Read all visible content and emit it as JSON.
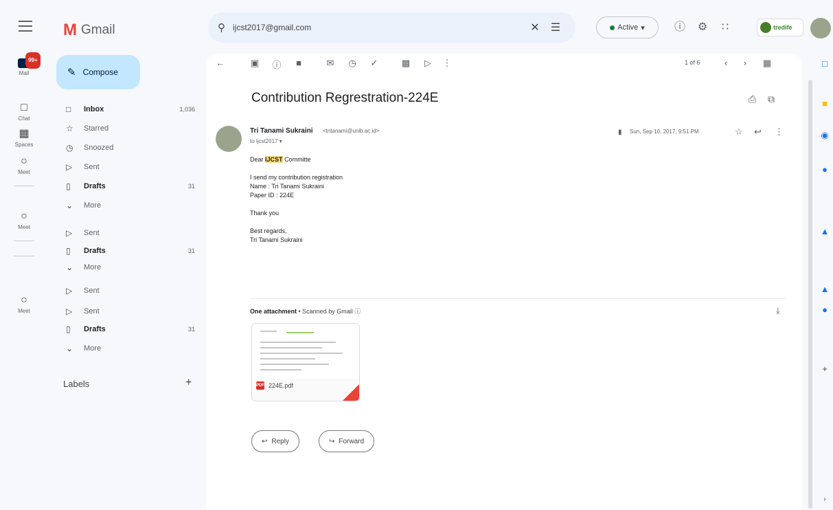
{
  "header": {
    "app_name": "Gmail",
    "search_value": "ijcst2017@gmail.com",
    "status_label": "Active",
    "brand_label": "tredife"
  },
  "rail": {
    "mail_badge": "99+",
    "items": [
      {
        "label": "Mail",
        "icon": "mail-icon"
      },
      {
        "label": "Chat",
        "icon": "chat-icon"
      },
      {
        "label": "Spaces",
        "icon": "spaces-icon"
      },
      {
        "label": "Meet",
        "icon": "meet-icon"
      },
      {
        "label": "Meet",
        "icon": "meet-icon"
      },
      {
        "label": "Meet",
        "icon": "meet-icon"
      }
    ]
  },
  "sidebar": {
    "compose_label": "Compose",
    "items": [
      {
        "label": "Inbox",
        "count": "1,036",
        "icon": "inbox-icon",
        "bold": true
      },
      {
        "label": "Starred",
        "count": "",
        "icon": "star-icon",
        "bold": false
      },
      {
        "label": "Snoozed",
        "count": "",
        "icon": "clock-icon",
        "bold": false
      },
      {
        "label": "Sent",
        "count": "",
        "icon": "send-icon",
        "bold": false
      },
      {
        "label": "Drafts",
        "count": "31",
        "icon": "draft-icon",
        "bold": true
      },
      {
        "label": "More",
        "count": "",
        "icon": "chevron-down-icon",
        "bold": false
      },
      {
        "label": "Sent",
        "count": "",
        "icon": "send-icon",
        "bold": false
      },
      {
        "label": "Drafts",
        "count": "31",
        "icon": "draft-icon",
        "bold": true
      },
      {
        "label": "More",
        "count": "",
        "icon": "chevron-down-icon",
        "bold": false
      },
      {
        "label": "Sent",
        "count": "",
        "icon": "send-icon",
        "bold": false
      },
      {
        "label": "Sent",
        "count": "",
        "icon": "send-icon",
        "bold": false
      },
      {
        "label": "Drafts",
        "count": "31",
        "icon": "draft-icon",
        "bold": true
      },
      {
        "label": "More",
        "count": "",
        "icon": "chevron-down-icon",
        "bold": false
      }
    ],
    "labels_title": "Labels"
  },
  "message": {
    "pager": "1 of 6",
    "subject": "Contribution Regrestration-224E",
    "sender_name": "Tri Tanami Sukraini",
    "sender_email": "<tritanami@unib.ac.id>",
    "recipient": "to ijcst2017",
    "date": "Sun, Sep 10, 2017, 9:51 PM",
    "greeting_prefix": "Dear",
    "greeting_highlight": "IJCST",
    "greeting_suffix": "Committe",
    "line1": "I send my contribution registration",
    "line2": "Name : Tri Tanami Sukraini",
    "line3": "Paper ID : 224E",
    "thanks": "Thank you",
    "closing": "Best regards,",
    "signature": "Tri Tanami Sukraini"
  },
  "attachment": {
    "title_bold": "One attachment",
    "title_rest": " •  Scanned by Gmail ⓘ",
    "file_name": "224E.pdf",
    "file_type": "PDF"
  },
  "actions": {
    "reply": "Reply",
    "forward": "Forward"
  },
  "colors": {
    "accent": "#c2e7ff",
    "highlight": "#fbd97a",
    "pdf": "#d93025"
  }
}
